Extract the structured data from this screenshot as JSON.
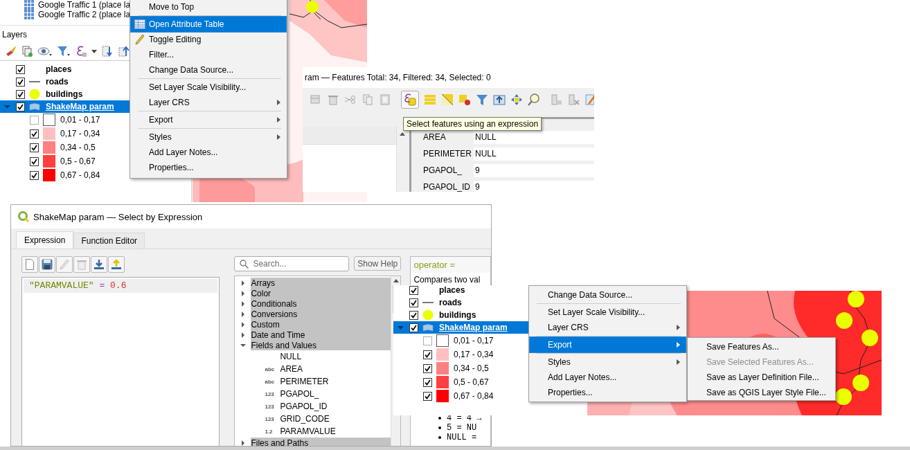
{
  "layers_panel": {
    "top_items": [
      "Google Traffic 1 (place la",
      "Google Traffic 2 (place la"
    ],
    "title": "Layers",
    "tree": [
      {
        "name": "places",
        "checked": true,
        "kind": "none",
        "selected": false
      },
      {
        "name": "roads",
        "checked": true,
        "kind": "line",
        "selected": false
      },
      {
        "name": "buildings",
        "checked": true,
        "kind": "point",
        "selected": false
      },
      {
        "name": "ShakeMap param",
        "checked": true,
        "kind": "polygon",
        "selected": true,
        "expanded": true,
        "children": [
          {
            "label": "0,01 - 0,17",
            "checked": false,
            "color": "#ffffff"
          },
          {
            "label": "0,17 - 0,34",
            "checked": true,
            "color": "#ffbfbf"
          },
          {
            "label": "0,34 - 0,5",
            "checked": true,
            "color": "#ff8080"
          },
          {
            "label": "0,5 - 0,67",
            "checked": true,
            "color": "#ff4040"
          },
          {
            "label": "0,67 - 0,84",
            "checked": true,
            "color": "#ff0000"
          }
        ]
      }
    ]
  },
  "layer_menu": {
    "items": [
      {
        "label": "Move to Top",
        "kind": "item",
        "selected": false
      },
      {
        "kind": "separator"
      },
      {
        "label": "Open Attribute Table",
        "kind": "table",
        "selected": true
      },
      {
        "label": "Toggle Editing",
        "kind": "pencil",
        "selected": false
      },
      {
        "label": "Filter...",
        "kind": "item",
        "selected": false
      },
      {
        "label": "Change Data Source...",
        "kind": "item",
        "selected": false
      },
      {
        "kind": "separator"
      },
      {
        "label": "Set Layer Scale Visibility...",
        "kind": "item",
        "selected": false
      },
      {
        "label": "Layer CRS",
        "kind": "submenu",
        "selected": false
      },
      {
        "kind": "separator"
      },
      {
        "label": "Export",
        "kind": "submenu",
        "selected": false
      },
      {
        "kind": "separator"
      },
      {
        "label": "Styles",
        "kind": "submenu",
        "selected": false
      },
      {
        "label": "Add Layer Notes...",
        "kind": "item",
        "selected": false
      },
      {
        "label": "Properties...",
        "kind": "item",
        "selected": false
      }
    ]
  },
  "attribute_table": {
    "title": "ram — Features Total: 34, Filtered: 34, Selected: 0",
    "tooltip": "Select features using an expression",
    "fields": [
      {
        "name": "AREA",
        "value": "NULL"
      },
      {
        "name": "PERIMETER",
        "value": "NULL"
      },
      {
        "name": "PGAPOL_",
        "value": "9"
      },
      {
        "name": "PGAPOL_ID",
        "value": "9"
      }
    ]
  },
  "expression_dialog": {
    "title": "ShakeMap param — Select by Expression",
    "tabs": [
      {
        "label": "Expression",
        "selected": true
      },
      {
        "label": "Function Editor",
        "selected": false
      }
    ],
    "expression": [
      {
        "text": "\"PARAMVALUE\"",
        "kind": "field"
      },
      {
        "text": "=",
        "kind": "operator"
      },
      {
        "text": "0.6",
        "kind": "number"
      }
    ],
    "search": {
      "placeholder": "Search..."
    },
    "show_help": "Show Help",
    "groups": [
      {
        "label": "Arrays",
        "expanded": false
      },
      {
        "label": "Color",
        "expanded": false
      },
      {
        "label": "Conditionals",
        "expanded": false
      },
      {
        "label": "Conversions",
        "expanded": false
      },
      {
        "label": "Custom",
        "expanded": false
      },
      {
        "label": "Date and Time",
        "expanded": false
      },
      {
        "label": "Fields and Values",
        "expanded": true,
        "children": [
          {
            "label": "NULL"
          },
          {
            "type": "abc",
            "label": "AREA"
          },
          {
            "type": "abc",
            "label": "PERIMETER"
          },
          {
            "type": "123",
            "label": "PGAPOL_"
          },
          {
            "type": "123",
            "label": "PGAPOL_ID"
          },
          {
            "type": "123",
            "label": "GRID_CODE"
          },
          {
            "type": "1.2",
            "label": "PARAMVALUE"
          }
        ]
      },
      {
        "label": "Files and Paths",
        "expanded": false
      }
    ],
    "help": {
      "title": "operator =",
      "text": "Compares two val",
      "examples": [
        "4 = 4 →",
        "5 = NU",
        "NULL ="
      ]
    }
  },
  "layers_panel_2": {
    "tree": [
      {
        "name": "places",
        "checked": true,
        "kind": "none",
        "selected": false
      },
      {
        "name": "roads",
        "checked": true,
        "kind": "line",
        "selected": false
      },
      {
        "name": "buildings",
        "checked": true,
        "kind": "point",
        "selected": false
      },
      {
        "name": "ShakeMap param",
        "checked": true,
        "kind": "polygon",
        "selected": true,
        "expanded": true,
        "children": [
          {
            "label": "0,01 - 0,17",
            "checked": false,
            "color": "#ffffff"
          },
          {
            "label": "0,17 - 0,34",
            "checked": true,
            "color": "#ffbfbf"
          },
          {
            "label": "0,34 - 0,5",
            "checked": true,
            "color": "#ff8080"
          },
          {
            "label": "0,5 - 0,67",
            "checked": true,
            "color": "#ff4040"
          },
          {
            "label": "0,67 - 0,84",
            "checked": true,
            "color": "#ff0000"
          }
        ]
      }
    ]
  },
  "layer_menu_2": {
    "items": [
      {
        "label": "Change Data Source...",
        "kind": "item",
        "selected": false
      },
      {
        "kind": "separator"
      },
      {
        "label": "Set Layer Scale Visibility...",
        "kind": "item",
        "selected": false
      },
      {
        "label": "Layer CRS",
        "kind": "submenu",
        "selected": false
      },
      {
        "kind": "separator"
      },
      {
        "label": "Export",
        "kind": "submenu",
        "selected": true
      },
      {
        "kind": "separator"
      },
      {
        "label": "Styles",
        "kind": "submenu",
        "selected": false
      },
      {
        "label": "Add Layer Notes...",
        "kind": "item",
        "selected": false
      },
      {
        "label": "Properties...",
        "kind": "item",
        "selected": false
      }
    ]
  },
  "export_submenu": {
    "items": [
      {
        "label": "Save Features As...",
        "disabled": false
      },
      {
        "label": "Save Selected Features As...",
        "disabled": true
      },
      {
        "label": "Save as Layer Definition File...",
        "disabled": false
      },
      {
        "label": "Save as QGIS Layer Style File...",
        "disabled": false
      }
    ]
  }
}
